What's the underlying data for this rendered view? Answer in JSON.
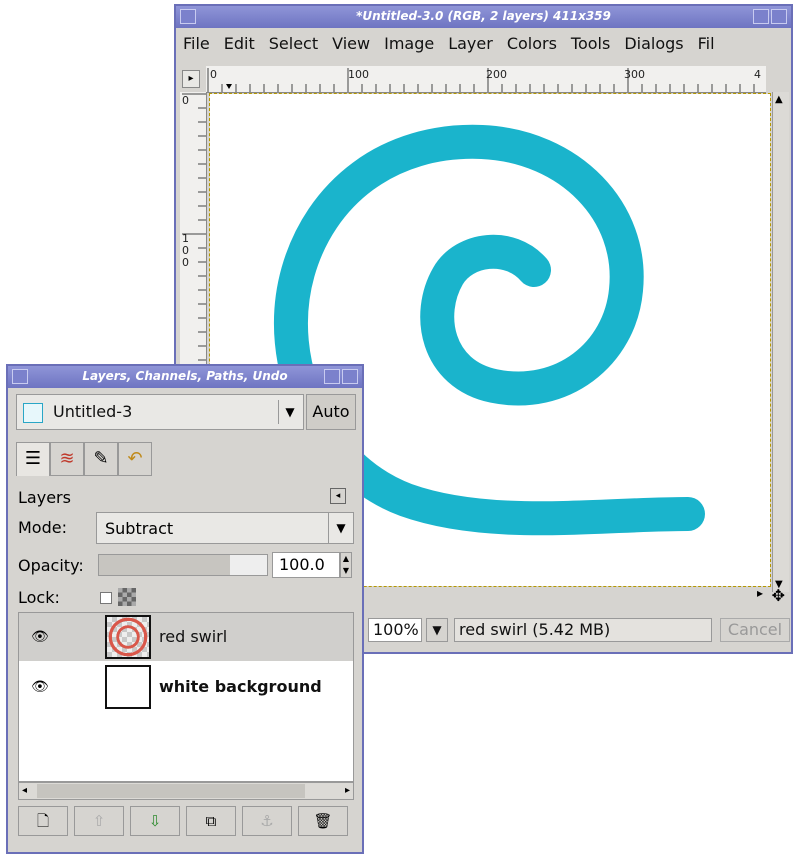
{
  "image_window": {
    "title": "*Untitled-3.0 (RGB, 2 layers) 411x359",
    "menu": [
      "File",
      "Edit",
      "Select",
      "View",
      "Image",
      "Layer",
      "Colors",
      "Tools",
      "Dialogs",
      "Fil"
    ],
    "ruler_h": [
      "0",
      "100",
      "200",
      "300",
      "4"
    ],
    "ruler_v": [
      "0",
      "1",
      "0",
      "0"
    ],
    "stroke_color": "#1ab4cc",
    "status": {
      "zoom": "100%",
      "message": "red swirl (5.42 MB)",
      "cancel": "Cancel"
    }
  },
  "layers_dialog": {
    "title": "Layers, Channels, Paths, Undo",
    "image_select": "Untitled-3",
    "auto_button": "Auto",
    "tab_icons": [
      "layers-tab-icon",
      "channels-tab-icon",
      "paths-tab-icon",
      "undo-tab-icon"
    ],
    "section_label": "Layers",
    "mode_label": "Mode:",
    "mode_value": "Subtract",
    "opacity_label": "Opacity:",
    "opacity_value": "100.0",
    "opacity_fraction": 0.78,
    "lock_label": "Lock:",
    "layers": [
      {
        "name": "red swirl",
        "selected": true,
        "bold": false
      },
      {
        "name": "white background",
        "selected": false,
        "bold": true
      }
    ],
    "bottom_buttons": [
      "new-layer-icon",
      "raise-layer-icon",
      "lower-layer-icon",
      "duplicate-layer-icon",
      "anchor-layer-icon",
      "delete-layer-icon"
    ]
  }
}
